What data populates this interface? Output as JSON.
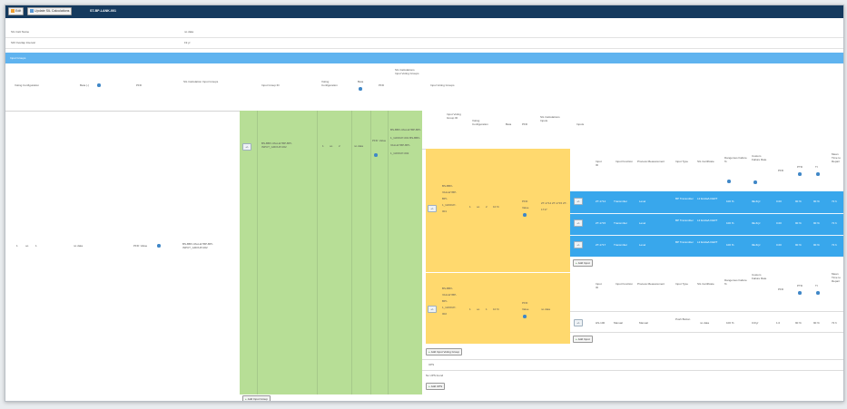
{
  "toolbar": {
    "edit_label": "Edit",
    "update_label": "Update SIL Calculations",
    "title": "ST-BP-LANK-001"
  },
  "info": {
    "rows": [
      {
        "label": "SIL Calc Name",
        "value": "no data"
      },
      {
        "label": "SIF Overlap Interval",
        "value": "19 yr"
      }
    ]
  },
  "section_bar": {
    "label": "Input Groups"
  },
  "table_header": {
    "voting_config": "Voting Configuration",
    "beta": "Beta (-)",
    "pfd": "PFD",
    "sil_calc_input_groups": "SIL Calculation Input Groups",
    "input_group_id": "Input Group ID",
    "voting_config2": "Voting Configuration",
    "beta2": "Beta",
    "pfd2": "PFD",
    "sil_calc_input_voting": "SIL Calculations Input Voting Groups",
    "input_voting_groups": "Input Voting Groups"
  },
  "left_row": {
    "voting_a": "1",
    "voting_oo": "oo",
    "voting_b": "1",
    "beta": "no data",
    "pfd": "PFD: Value",
    "groups": "BS-BBV-VALLEYBP-BPI-INPUT_GROUP-002"
  },
  "green_row": {
    "expand": "+/-",
    "group_id": "BS-BBV-VALLEYBP-BPI-INPUT_GROUP-002",
    "v1": "1",
    "v_oo": "oo",
    "v2": "2",
    "beta": "no data",
    "pfd": "PFD: Value",
    "voting_groups": "BS-BBV-VALLEYBP-BPI-1_GROUP-001 BS-BBV-VALLEYBP-BPI-1_GROUP-002"
  },
  "sub_header": {
    "ivg_id": "Input Voting Group ID",
    "voting_config": "Voting Configuration",
    "beta": "Beta",
    "pfd": "PFD",
    "sil_calc_inputs": "SIL Calculations Inputs",
    "inputs": "Inputs"
  },
  "yellow_rows": [
    {
      "expand": "+/-",
      "id": "BS-BBV-VALLEYBP-BPI-1_GROUP-001",
      "v1": "1",
      "oo": "oo",
      "v2": "2",
      "beta": "10 %",
      "pfd": "PFD: Value",
      "calc_inputs": "ZT-1714 ZT-1715 ZT-1717"
    },
    {
      "expand": "+/-",
      "id": "BS-BBV-VALLEYBP-BPI-1_GROUP-002",
      "v1": "1",
      "oo": "oo",
      "v2": "1",
      "beta": "10 %",
      "pfd": "PFD: Value",
      "calc_inputs": "no data"
    }
  ],
  "inputs_header": {
    "id": "Input ID",
    "function": "Input Function",
    "process_measurement": "Process Measurement",
    "type": "Input Type",
    "sil_cert": "SIL Certificate",
    "dangerous_failure": "Dangerous Failure %",
    "custom_failure_rate": "Custom Failure Rate",
    "pfd": "PFD",
    "pfd2": "PTD",
    "ti": "TI",
    "mttr": "Mean Time to Repair"
  },
  "blue_rows": [
    {
      "btn": "+/-",
      "id": "ZT-1714",
      "function": "Transmitter",
      "pm": "Level",
      "type": "BP Transmitter",
      "cert": "L2 Exida/LCERT",
      "df": "100 %",
      "cfr": "0E-6/yr",
      "pfd": "0.00",
      "ptd": "90 %",
      "ti": "90 %",
      "mttr": "72 h"
    },
    {
      "btn": "+/-",
      "id": "ZT-1715",
      "function": "Transmitter",
      "pm": "Level",
      "type": "BP Transmitter",
      "cert": "L2 Exida/LCERT",
      "df": "100 %",
      "cfr": "0E-6/yr",
      "pfd": "0.00",
      "ptd": "90 %",
      "ti": "90 %",
      "mttr": "72 h"
    },
    {
      "btn": "+/-",
      "id": "ZT-1717",
      "function": "Transmitter",
      "pm": "Level",
      "type": "BP Transmitter",
      "cert": "L2 Exida/LCERT",
      "df": "100 %",
      "cfr": "0E-6/yr",
      "pfd": "0.00",
      "ptd": "90 %",
      "ti": "90 %",
      "mttr": "72 h"
    }
  ],
  "white_row": {
    "btn": "+/-",
    "id": "HS-100",
    "function": "Manual",
    "pm": "Manual",
    "type": "Push Button",
    "cert": "no data",
    "df": "100 %",
    "cfr": "0.0/yr",
    "pfd": "1.0",
    "ptd": "90 %",
    "ti": "90 %",
    "mttr": "72 h"
  },
  "buttons": {
    "add_input": "Add Input",
    "add_input2": "Add Input",
    "add_voting_group": "Add Input Voting Group",
    "add_input_group": "Add Input Group",
    "add_ups": "Add UPS"
  },
  "ups": {
    "label": "UPS",
    "value": "No UPS found"
  }
}
